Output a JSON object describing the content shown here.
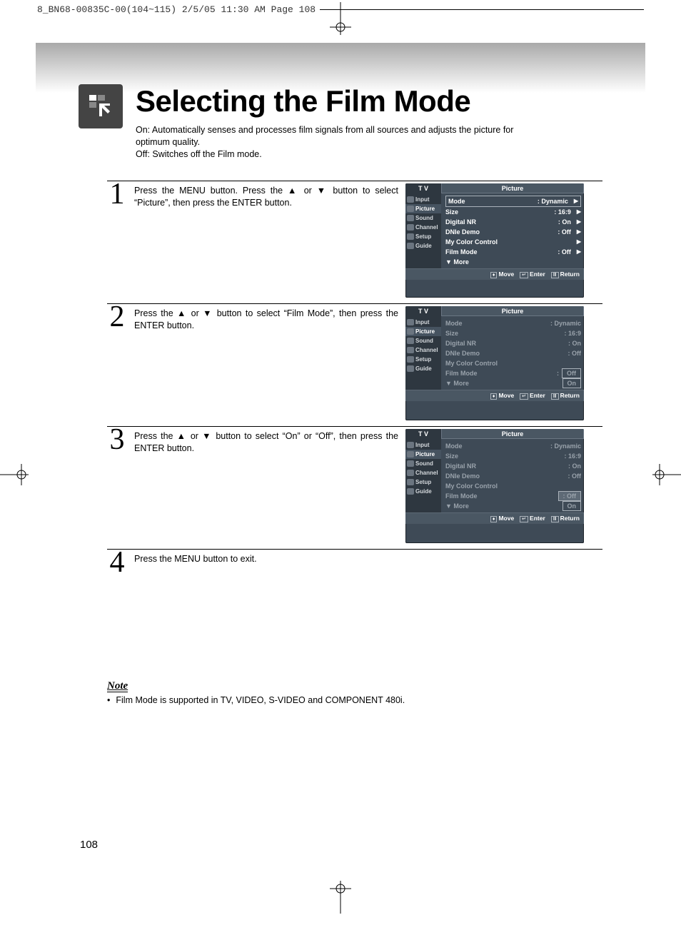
{
  "print_header": "8_BN68-00835C-00(104~115)  2/5/05  11:30 AM  Page 108",
  "heading": "Selecting the Film Mode",
  "intro_line1": "On: Automatically senses and processes film signals from all sources and adjusts the picture for optimum quality.",
  "intro_line2": "Off: Switches off the Film mode.",
  "steps": {
    "s1": {
      "num": "1",
      "text": "Press the MENU button. Press the ▲ or ▼ button to select “Picture”, then press the ENTER button."
    },
    "s2": {
      "num": "2",
      "text": "Press the ▲ or ▼ button to select “Film Mode”, then press the ENTER button."
    },
    "s3": {
      "num": "3",
      "text": "Press the ▲ or ▼ button to select “On” or “Off”, then press the ENTER button."
    },
    "s4": {
      "num": "4",
      "text": "Press the MENU button to exit."
    }
  },
  "osd": {
    "tv": "T V",
    "panel_title": "Picture",
    "side": [
      "Input",
      "Picture",
      "Sound",
      "Channel",
      "Setup",
      "Guide"
    ],
    "rows": {
      "mode_l": "Mode",
      "mode_v": ": Dynamic",
      "size_l": "Size",
      "size_v": ": 16:9",
      "dnr_l": "Digital NR",
      "dnr_v": ": On",
      "dnie_l": "DNIe Demo",
      "dnie_v": ": Off",
      "mcc_l": "My Color Control",
      "film_l": "Film Mode",
      "film_v": ": Off",
      "more": "▼ More"
    },
    "opts": {
      "off": "Off",
      "on": "On",
      "off_colon": ": Off"
    },
    "footer": {
      "move": "Move",
      "enter": "Enter",
      "return": "Return"
    }
  },
  "note": {
    "title": "Note",
    "bullet": "•",
    "text": "Film Mode is supported in TV, VIDEO, S-VIDEO and COMPONENT 480i."
  },
  "page_num": "108"
}
